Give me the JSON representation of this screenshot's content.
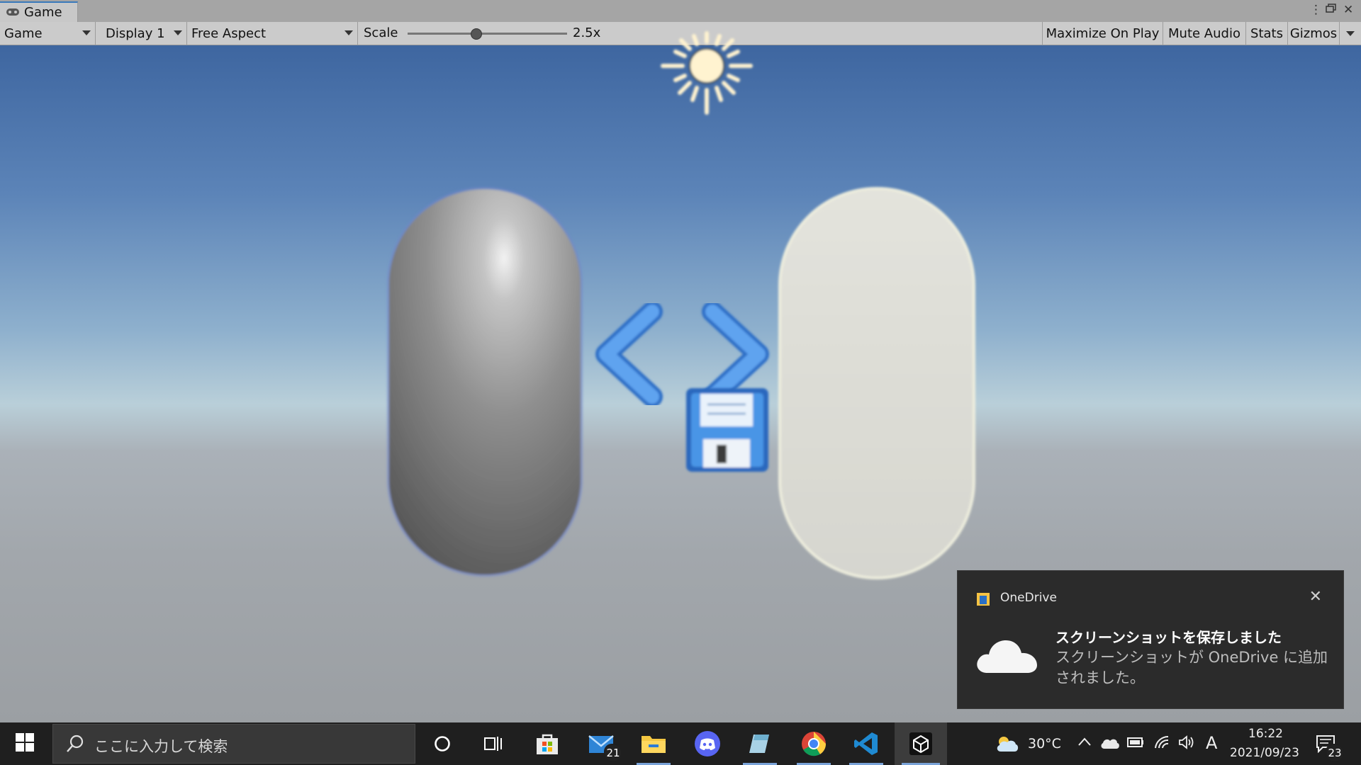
{
  "window": {
    "tab_label": "Game",
    "menu_icon": "kebab-menu-icon",
    "maximize_icon": "restore-window-icon",
    "close_icon": "close-icon"
  },
  "toolbar": {
    "view_mode": "Game",
    "display": "Display 1",
    "aspect": "Free Aspect",
    "scale_label": "Scale",
    "scale_value": "2.5x",
    "scale_fraction": 0.43,
    "maximize_on_play": "Maximize On Play",
    "mute_audio": "Mute Audio",
    "stats": "Stats",
    "gizmos": "Gizmos"
  },
  "scene": {
    "sky_top": "#3e66a0",
    "horizon": "#b9cfd9",
    "ground": "#9b9fa3",
    "objects": [
      "sun-light-gizmo",
      "metal-capsule",
      "white-capsule",
      "code-brackets-icon",
      "floppy-save-icon"
    ]
  },
  "toast": {
    "app_name": "OneDrive",
    "title": "スクリーンショットを保存しました",
    "body": "スクリーンショットが OneDrive に追加されました。"
  },
  "taskbar": {
    "search_placeholder": "ここに入力して検索",
    "mail_badge": "21",
    "weather_temp": "30°C",
    "ime_indicator": "A",
    "time": "16:22",
    "date": "2021/09/23",
    "notification_count": "23",
    "apps": [
      "start-icon",
      "search-icon",
      "cortana-icon",
      "task-view-icon",
      "store-icon",
      "mail-icon",
      "file-explorer-icon",
      "discord-icon",
      "notepad-icon",
      "chrome-icon",
      "vscode-icon",
      "unity-icon"
    ]
  }
}
